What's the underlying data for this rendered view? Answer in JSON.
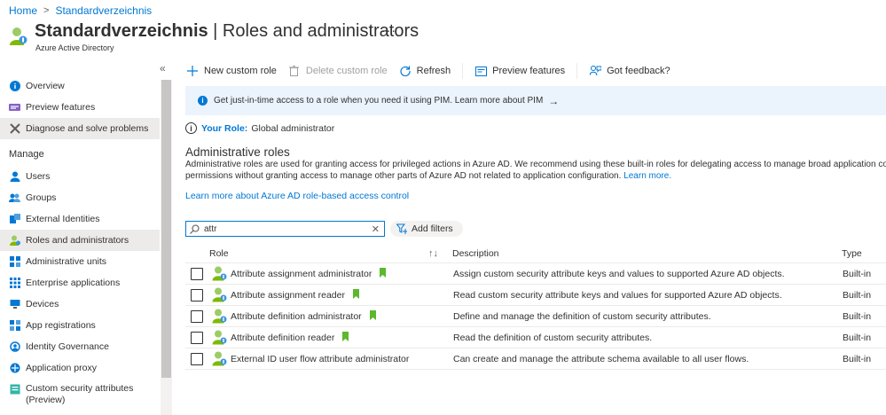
{
  "breadcrumb": {
    "home": "Home",
    "current": "Standardverzeichnis"
  },
  "header": {
    "title_bold": "Standardverzeichnis",
    "title_rest": " | Roles and administrators",
    "more": "···",
    "subtitle": "Azure Active Directory"
  },
  "sidebar": {
    "collapse": "«",
    "manage_label": "Manage",
    "items": [
      {
        "label": "Overview",
        "icon": "info-icon"
      },
      {
        "label": "Preview features",
        "icon": "preview-icon"
      },
      {
        "label": "Diagnose and solve problems",
        "icon": "wrench-icon"
      },
      {
        "label": "Users",
        "icon": "user-icon"
      },
      {
        "label": "Groups",
        "icon": "group-icon"
      },
      {
        "label": "External Identities",
        "icon": "external-identities-icon"
      },
      {
        "label": "Roles and administrators",
        "icon": "role-icon"
      },
      {
        "label": "Administrative units",
        "icon": "admin-units-icon"
      },
      {
        "label": "Enterprise applications",
        "icon": "enterprise-apps-icon"
      },
      {
        "label": "Devices",
        "icon": "device-icon"
      },
      {
        "label": "App registrations",
        "icon": "app-registrations-icon"
      },
      {
        "label": "Identity Governance",
        "icon": "governance-icon"
      },
      {
        "label": "Application proxy",
        "icon": "app-proxy-icon"
      },
      {
        "label": "Custom security attributes\n(Preview)",
        "icon": "security-attributes-icon"
      }
    ]
  },
  "toolbar": {
    "new_role": "New custom role",
    "delete_role": "Delete custom role",
    "refresh": "Refresh",
    "preview": "Preview features",
    "feedback": "Got feedback?"
  },
  "banner": {
    "text": "Get just-in-time access to a role when you need it using PIM. Learn more about PIM",
    "arrow": "→"
  },
  "your_role": {
    "label": "Your Role:",
    "value": "Global administrator"
  },
  "admin_roles": {
    "title": "Administrative roles",
    "desc_line1": "Administrative roles are used for granting access for privileged actions in Azure AD. We recommend using these built-in roles for delegating access to manage broad application co",
    "desc_line2": "permissions without granting access to manage other parts of Azure AD not related to application configuration.",
    "desc_link": "Learn more.",
    "learn_link": "Learn more about Azure AD role-based access control"
  },
  "search": {
    "value": "attr",
    "clear": "✕"
  },
  "add_filters": "Add filters",
  "table": {
    "headers": {
      "role": "Role",
      "sort": "↑↓",
      "description": "Description",
      "type": "Type"
    },
    "rows": [
      {
        "role": "Attribute assignment administrator",
        "description": "Assign custom security attribute keys and values to supported Azure AD objects.",
        "type": "Built-in",
        "bookmark": true
      },
      {
        "role": "Attribute assignment reader",
        "description": "Read custom security attribute keys and values for supported Azure AD objects.",
        "type": "Built-in",
        "bookmark": true
      },
      {
        "role": "Attribute definition administrator",
        "description": "Define and manage the definition of custom security attributes.",
        "type": "Built-in",
        "bookmark": true
      },
      {
        "role": "Attribute definition reader",
        "description": "Read the definition of custom security attributes.",
        "type": "Built-in",
        "bookmark": true
      },
      {
        "role": "External ID user flow attribute administrator",
        "description": "Can create and manage the attribute schema available to all user flows.",
        "type": "Built-in",
        "bookmark": false
      }
    ]
  },
  "colors": {
    "accent": "#0078d4",
    "bookmark": "#5cb82e",
    "role_icon_green": "#7fba00"
  }
}
